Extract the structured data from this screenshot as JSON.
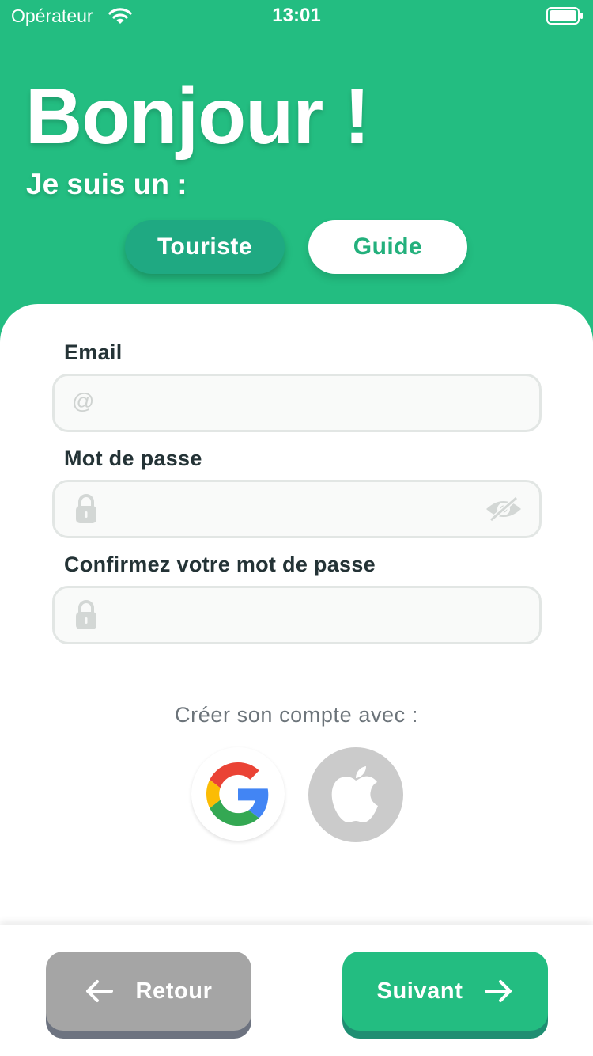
{
  "status_bar": {
    "carrier": "Opérateur",
    "time": "13:01"
  },
  "header": {
    "title": "Bonjour !",
    "subtitle": "Je suis un :"
  },
  "roles": {
    "tourist": "Touriste",
    "guide": "Guide",
    "selected": "Touriste"
  },
  "form": {
    "email": {
      "label": "Email",
      "placeholder": "",
      "value": "",
      "icon": "at-icon"
    },
    "password": {
      "label": "Mot de passe",
      "value": "",
      "icon": "lock-icon",
      "toggle_icon": "eye-slash-icon"
    },
    "confirm_password": {
      "label": "Confirmez votre mot de passe",
      "value": "",
      "icon": "lock-icon"
    }
  },
  "social": {
    "label": "Créer son compte avec :",
    "providers": [
      "google",
      "apple"
    ]
  },
  "navigation": {
    "back_label": "Retour",
    "next_label": "Suivant"
  },
  "colors": {
    "primary": "#23bd81",
    "selected_role": "#1fa982",
    "back_button": "#a5a5a5",
    "text_dark": "#243336"
  }
}
